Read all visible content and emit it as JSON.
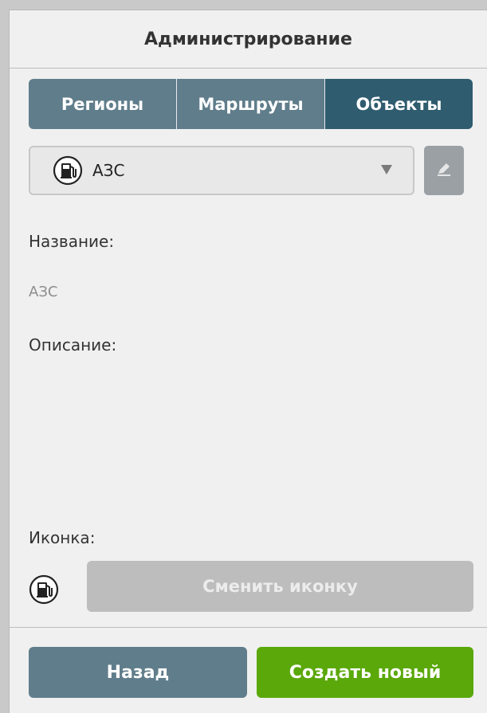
{
  "header": {
    "title": "Администрирование"
  },
  "tabs": [
    {
      "label": "Регионы",
      "active": false
    },
    {
      "label": "Маршруты",
      "active": false
    },
    {
      "label": "Объекты",
      "active": true
    }
  ],
  "object_select": {
    "value": "АЗС",
    "icon": "gas-station-icon"
  },
  "form": {
    "name_label": "Название:",
    "name_value": "АЗС",
    "description_label": "Описание:",
    "description_value": "",
    "icon_label": "Иконка:",
    "icon": "gas-station-icon",
    "change_icon_label": "Сменить иконку"
  },
  "footer": {
    "back_label": "Назад",
    "create_label": "Создать новый"
  },
  "colors": {
    "tab": "#607d8b",
    "tab_active": "#2f5c6f",
    "create": "#5aa80a",
    "disabled": "#bdbdbd"
  }
}
